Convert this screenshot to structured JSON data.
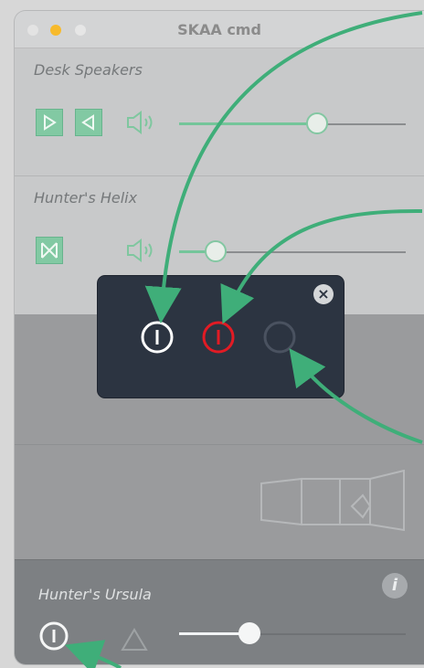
{
  "window": {
    "title": "SKAA cmd"
  },
  "devices": [
    {
      "name": "Desk Speakers",
      "volume_fraction": 0.61
    },
    {
      "name": "Hunter's Helix",
      "volume_fraction": 0.16
    }
  ],
  "bottom_device": {
    "name": "Hunter's Ursula",
    "info_label": "i",
    "volume_fraction": 0.31
  },
  "popup": {
    "close_label": "×",
    "buttons": [
      "power-on-white",
      "power-on-red",
      "power-off-empty"
    ]
  },
  "colors": {
    "accent_green": "#74c59a",
    "red": "#e21b24",
    "popup_bg": "#2c3441",
    "arrow_green": "#3fae79"
  },
  "icons": {
    "play_right": "play-right-icon",
    "play_left": "play-left-icon",
    "speaker": "speaker-icon",
    "bowtie": "bowtie-icon",
    "power": "power-icon",
    "info": "info-icon",
    "triangle": "triangle-icon",
    "close": "close-icon"
  }
}
